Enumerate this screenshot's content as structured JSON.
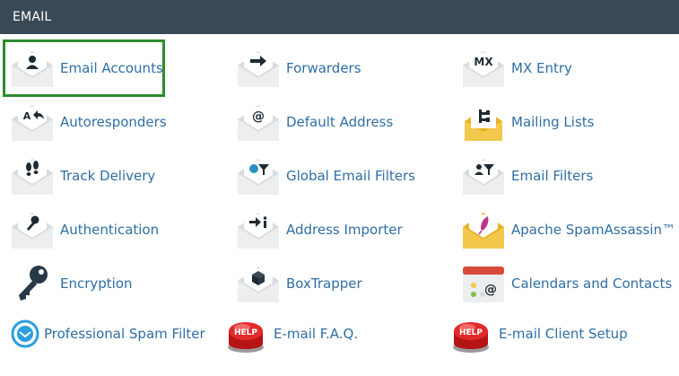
{
  "section": {
    "title": "EMAIL"
  },
  "colors": {
    "header_bg": "#3a4956",
    "link": "#2f6ea4",
    "highlight": "#2e8b2e"
  },
  "items": [
    {
      "label": "Email Accounts",
      "icon": "user-envelope-icon"
    },
    {
      "label": "Forwarders",
      "icon": "arrow-envelope-icon"
    },
    {
      "label": "MX Entry",
      "icon": "mx-envelope-icon"
    },
    {
      "label": "Autoresponders",
      "icon": "autoresponder-envelope-icon"
    },
    {
      "label": "Default Address",
      "icon": "at-envelope-icon"
    },
    {
      "label": "Mailing Lists",
      "icon": "mailing-list-envelope-icon"
    },
    {
      "label": "Track Delivery",
      "icon": "footprints-envelope-icon"
    },
    {
      "label": "Global Email Filters",
      "icon": "global-filter-envelope-icon"
    },
    {
      "label": "Email Filters",
      "icon": "filter-envelope-icon"
    },
    {
      "label": "Authentication",
      "icon": "key-envelope-icon"
    },
    {
      "label": "Address Importer",
      "icon": "import-envelope-icon"
    },
    {
      "label": "Apache SpamAssassin™",
      "icon": "feather-envelope-icon"
    },
    {
      "label": "Encryption",
      "icon": "key-icon"
    },
    {
      "label": "BoxTrapper",
      "icon": "box-envelope-icon"
    },
    {
      "label": "Calendars and Contacts",
      "icon": "calendar-icon"
    },
    {
      "label": "Professional Spam Filter",
      "icon": "spam-filter-icon"
    },
    {
      "label": "E-mail F.A.Q.",
      "icon": "help-button-icon"
    },
    {
      "label": "E-mail Client Setup",
      "icon": "help-button-icon"
    }
  ]
}
